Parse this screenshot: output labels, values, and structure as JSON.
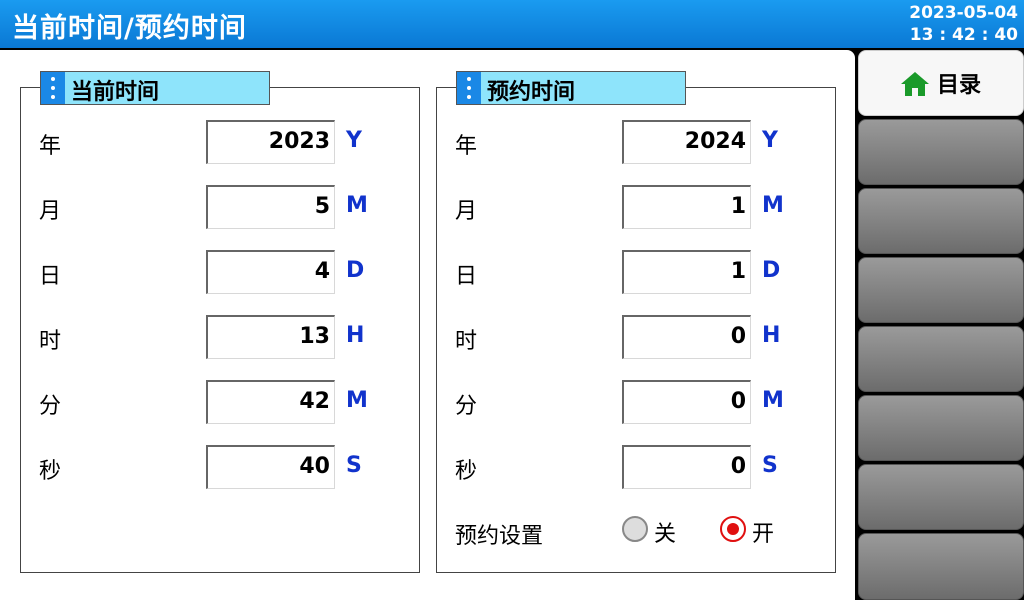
{
  "header": {
    "title": "当前时间/预约时间",
    "date": "2023-05-04",
    "time": "13 : 42 : 40"
  },
  "current_panel": {
    "title": "当前时间",
    "rows": [
      {
        "label": "年",
        "value": "2023",
        "unit": "Y"
      },
      {
        "label": "月",
        "value": "5",
        "unit": "M"
      },
      {
        "label": "日",
        "value": "4",
        "unit": "D"
      },
      {
        "label": "时",
        "value": "13",
        "unit": "H"
      },
      {
        "label": "分",
        "value": "42",
        "unit": "M"
      },
      {
        "label": "秒",
        "value": "40",
        "unit": "S"
      }
    ]
  },
  "reserve_panel": {
    "title": "预约时间",
    "rows": [
      {
        "label": "年",
        "value": "2024",
        "unit": "Y"
      },
      {
        "label": "月",
        "value": "1",
        "unit": "M"
      },
      {
        "label": "日",
        "value": "1",
        "unit": "D"
      },
      {
        "label": "时",
        "value": "0",
        "unit": "H"
      },
      {
        "label": "分",
        "value": "0",
        "unit": "M"
      },
      {
        "label": "秒",
        "value": "0",
        "unit": "S"
      }
    ],
    "setting": {
      "label": "预约设置",
      "off_label": "关",
      "on_label": "开",
      "selected": "开"
    }
  },
  "sidebar": {
    "menu_label": "目录",
    "menu_icon": "home-icon",
    "empty_buttons": 7
  },
  "colors": {
    "header_blue": "#0a78d4",
    "tab_cyan": "#8ee4fb",
    "unit_blue": "#1133cc",
    "radio_red": "#e01010",
    "home_green": "#1a9a2a"
  }
}
